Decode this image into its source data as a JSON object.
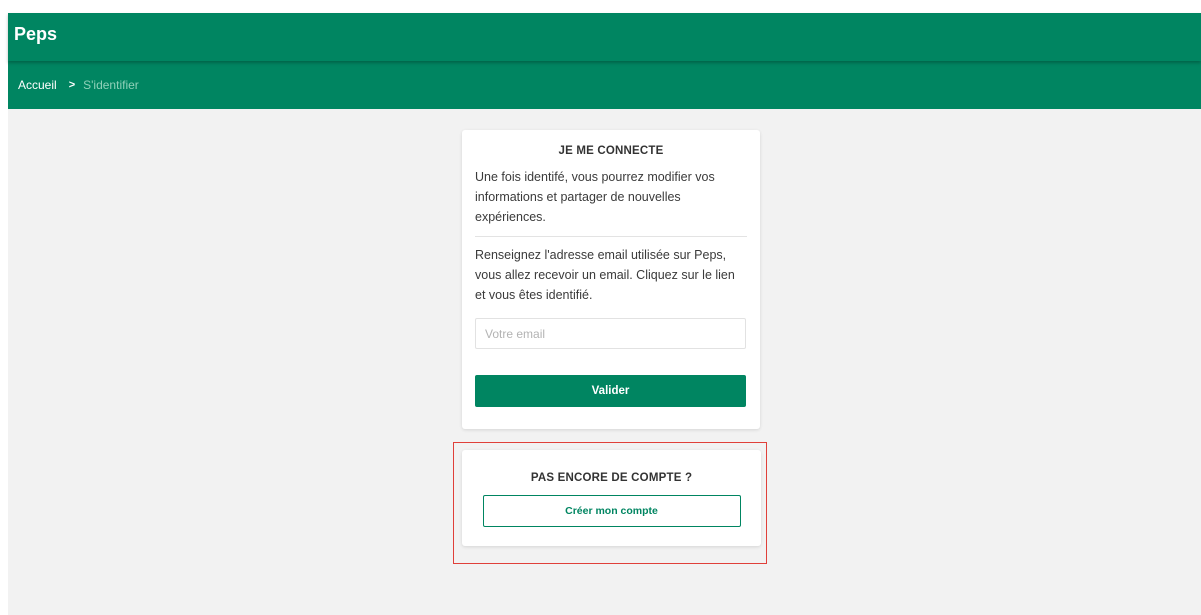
{
  "header": {
    "app_title": "Peps"
  },
  "breadcrumb": {
    "home_label": "Accueil",
    "separator": ">",
    "current_label": "S'identifier"
  },
  "login": {
    "heading": "JE ME CONNECTE",
    "intro": "Une fois identifé, vous pourrez modifier vos informations et partager de nouvelles expériences.",
    "instructions": "Renseignez l'adresse email utilisée sur Peps, vous allez recevoir un email. Cliquez sur le lien et vous êtes identifié.",
    "email_placeholder": "Votre email",
    "email_value": "",
    "submit_label": "Valider"
  },
  "signup": {
    "heading": "PAS ENCORE DE COMPTE ?",
    "create_label": "Créer mon compte"
  },
  "colors": {
    "brand_green": "#008561",
    "highlight_red": "#e0403a",
    "page_background": "#f2f2f2"
  }
}
